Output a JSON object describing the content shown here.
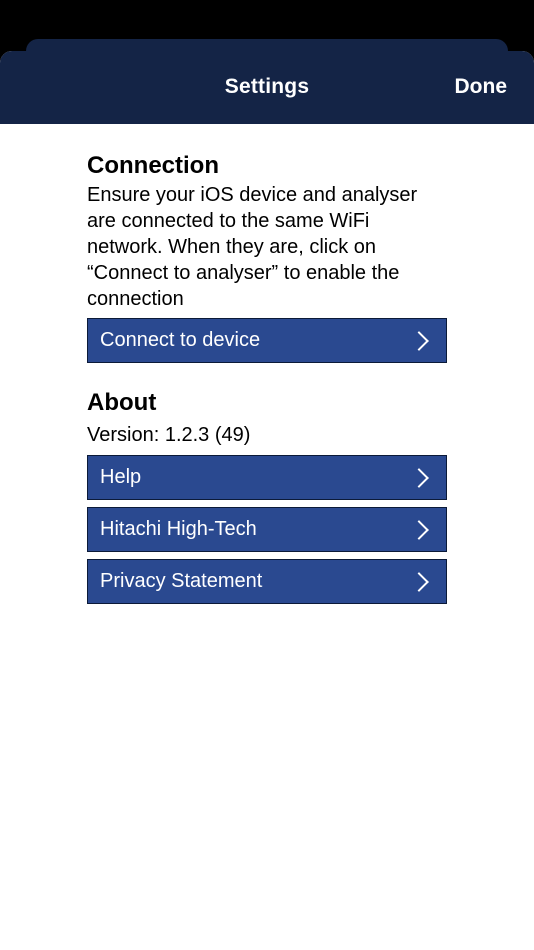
{
  "header": {
    "title": "Settings",
    "done_label": "Done"
  },
  "connection": {
    "title": "Connection",
    "description": "Ensure your iOS device and analyser are connected to the same WiFi network. When they are, click on “Connect to analyser” to enable the connection",
    "button_label": "Connect to device"
  },
  "about": {
    "title": "About",
    "version_text": "Version: 1.2.3 (49)",
    "items": [
      {
        "label": "Help"
      },
      {
        "label": "Hitachi High-Tech"
      },
      {
        "label": "Privacy Statement"
      }
    ]
  },
  "icons": {
    "row_chevron": "chevron-right-icon"
  },
  "colors": {
    "nav_background": "#142446",
    "button_background": "#2a4990",
    "button_border": "#0b1a38"
  }
}
